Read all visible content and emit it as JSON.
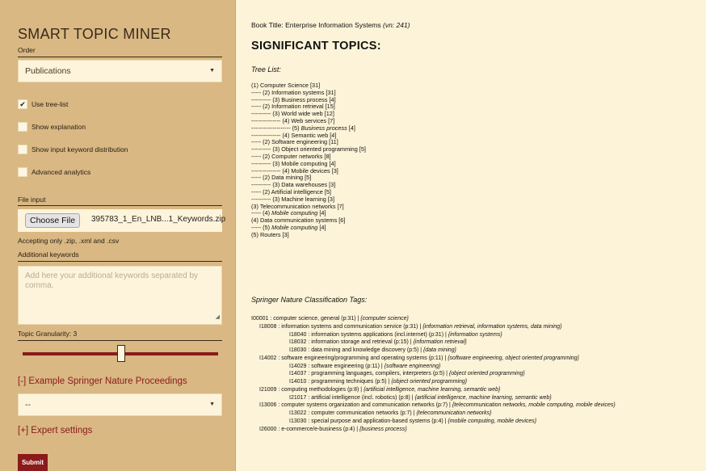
{
  "sidebar": {
    "title": "SMART TOPIC MINER",
    "order_label": "Order",
    "order_value": "Publications",
    "checkboxes": [
      {
        "label": "Use tree-list",
        "checked": true,
        "mark": "✔"
      },
      {
        "label": "Show explanation",
        "checked": false,
        "mark": ""
      },
      {
        "label": "Show input keyword distribution",
        "checked": false,
        "mark": ""
      },
      {
        "label": "Advanced analytics",
        "checked": false,
        "mark": ""
      }
    ],
    "file_input_label": "File input",
    "choose_file_label": "Choose File",
    "file_name": "395783_1_En_LNB...1_Keywords.zip",
    "accepting_note": "Accepting only .zip, .xml and .csv",
    "additional_keywords_label": "Additional keywords",
    "additional_keywords_placeholder": "Add here your additional keywords separated by comma.",
    "granularity_label": "Topic Granularity: 3",
    "granularity_value": 3,
    "example_proceedings_label": "[-] Example Springer Nature Proceedings",
    "example_select_value": "--",
    "expert_settings_label": "[+] Expert settings",
    "submit_label": "Submit",
    "accent_color": "#8b1a1a",
    "sidebar_color": "#d9b883"
  },
  "main": {
    "book_title_prefix": "Book Title: ",
    "book_title": "Enterprise Information Systems",
    "book_vn": " (vn: 241)",
    "heading": "SIGNIFICANT TOPICS:",
    "tree_heading": "Tree List:",
    "tree": [
      {
        "prefix": "",
        "text": "(1) Computer Science [31]",
        "italic_part": "",
        "suffix": ""
      },
      {
        "prefix": "",
        "text": "----- (2) Information systems [31]",
        "italic_part": "",
        "suffix": ""
      },
      {
        "prefix": "",
        "text": "---------- (3) Business process [4]",
        "italic_part": "",
        "suffix": ""
      },
      {
        "prefix": "",
        "text": "----- (2) Information retrieval [15]",
        "italic_part": "",
        "suffix": ""
      },
      {
        "prefix": "",
        "text": "---------- (3) World wide web [12]",
        "italic_part": "",
        "suffix": ""
      },
      {
        "prefix": "",
        "text": "--------------- (4) Web services [7]",
        "italic_part": "",
        "suffix": ""
      },
      {
        "prefix": "-------------------- (5) ",
        "text": "",
        "italic_part": "Business process",
        "suffix": " [4]"
      },
      {
        "prefix": "",
        "text": "--------------- (4) Semantic web [4]",
        "italic_part": "",
        "suffix": ""
      },
      {
        "prefix": "",
        "text": "----- (2) Software engineering [11]",
        "italic_part": "",
        "suffix": ""
      },
      {
        "prefix": "",
        "text": "---------- (3) Object oriented programming [5]",
        "italic_part": "",
        "suffix": ""
      },
      {
        "prefix": "",
        "text": "----- (2) Computer networks [8]",
        "italic_part": "",
        "suffix": ""
      },
      {
        "prefix": "",
        "text": "---------- (3) Mobile computing [4]",
        "italic_part": "",
        "suffix": ""
      },
      {
        "prefix": "",
        "text": "--------------- (4) Mobile devices [3]",
        "italic_part": "",
        "suffix": ""
      },
      {
        "prefix": "",
        "text": "----- (2) Data mining [5]",
        "italic_part": "",
        "suffix": ""
      },
      {
        "prefix": "",
        "text": "---------- (3) Data warehouses [3]",
        "italic_part": "",
        "suffix": ""
      },
      {
        "prefix": "",
        "text": "----- (2) Artificial intelligence [5]",
        "italic_part": "",
        "suffix": ""
      },
      {
        "prefix": "",
        "text": "---------- (3) Machine learning [3]",
        "italic_part": "",
        "suffix": ""
      },
      {
        "prefix": "",
        "text": "(3) Telecommunication networks [7]",
        "italic_part": "",
        "suffix": ""
      },
      {
        "prefix": "----- (4) ",
        "text": "",
        "italic_part": "Mobile computing",
        "suffix": " [4]"
      },
      {
        "prefix": "",
        "text": "(4) Data communication systems [6]",
        "italic_part": "",
        "suffix": ""
      },
      {
        "prefix": "----- (5) ",
        "text": "",
        "italic_part": "Mobile computing",
        "suffix": " [4]"
      },
      {
        "prefix": "",
        "text": "(5) Routers [3]",
        "italic_part": "",
        "suffix": ""
      }
    ],
    "tags_heading": "Springer Nature Classification Tags:",
    "tags": [
      {
        "level": 0,
        "text": "I00001 : computer science, general (p:31) | ",
        "topics": "{computer science}"
      },
      {
        "level": 1,
        "text": "I18008 : information systems and communication service (p:31) | ",
        "topics": "{information retrieval, information systems, data mining}"
      },
      {
        "level": 2,
        "text": "I18040 : information systems applications (incl.internet) (p:31) | ",
        "topics": "{information systems}"
      },
      {
        "level": 2,
        "text": "I18032 : information storage and retrieval (p:15) | ",
        "topics": "{information retrieval}"
      },
      {
        "level": 2,
        "text": "I18030 : data mining and knowledge discovery (p:5) | ",
        "topics": "{data mining}"
      },
      {
        "level": 1,
        "text": "I14002 : software engineering/programming and operating systems (p:11) | ",
        "topics": "{software engineering, object oriented programming}"
      },
      {
        "level": 2,
        "text": "I14029 : software engineering (p:11) | ",
        "topics": "{software engineering}"
      },
      {
        "level": 2,
        "text": "I14037 : programming languages, compilers, interpreters (p:5) | ",
        "topics": "{object oriented programming}"
      },
      {
        "level": 2,
        "text": "I14010 : programming techniques (p:5) | ",
        "topics": "{object oriented programming}"
      },
      {
        "level": 1,
        "text": "I21009 : computing methodologies (p:8) | ",
        "topics": "{artificial intelligence, machine learning, semantic web}"
      },
      {
        "level": 2,
        "text": "I21017 : artificial intelligence (incl. robotics) (p:8) | ",
        "topics": "{artificial intelligence, machine learning, semantic web}"
      },
      {
        "level": 1,
        "text": "I13006 : computer systems organization and communication networks (p:7) | ",
        "topics": "{telecommunication networks, mobile computing, mobile devices}"
      },
      {
        "level": 2,
        "text": "I13022 : computer communication networks (p:7) | ",
        "topics": "{telecommunication networks}"
      },
      {
        "level": 2,
        "text": "I13030 : special purpose and application-based systems (p:4) | ",
        "topics": "{mobile computing, mobile devices}"
      },
      {
        "level": 1,
        "text": "I26000 : e-commerce/e-business (p:4) | ",
        "topics": "{business process}"
      }
    ]
  }
}
